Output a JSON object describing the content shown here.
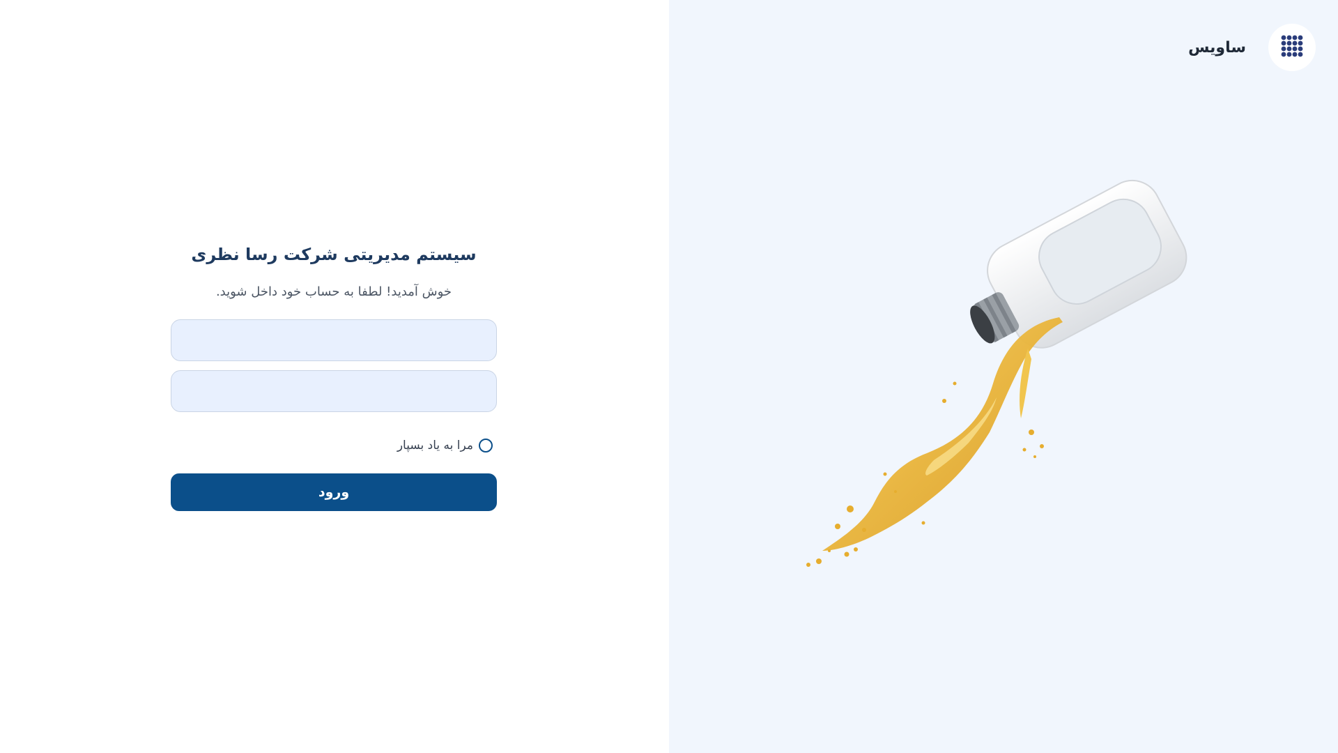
{
  "brand": {
    "name": "ساویس",
    "logo_icon": "grid-dots-icon",
    "logo_color": "#2a3c7a",
    "panel_background": "#f1f6fd"
  },
  "login": {
    "title": "سیستم مدیریتی شرکت رسا نظری",
    "subtitle": "خوش آمدید! لطفا به حساب خود داخل شوید.",
    "username": {
      "value": "",
      "placeholder": ""
    },
    "password": {
      "value": "",
      "placeholder": ""
    },
    "remember_label": "مرا به یاد بسپار",
    "remember_checked": false,
    "submit_label": "ورود",
    "accent_color": "#0b4f8a",
    "field_background": "#e8f0fe"
  },
  "illustration": {
    "icon": "oil-bottle-pouring-icon"
  }
}
